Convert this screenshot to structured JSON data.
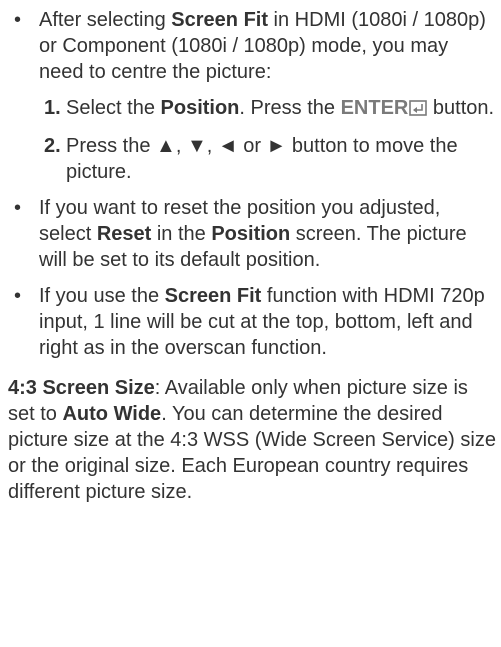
{
  "bullet1": {
    "pre": "After selecting ",
    "bold1": "Screen Fit",
    "post": " in HDMI (1080i / 1080p) or Component (1080i / 1080p) mode, you may need to centre the picture:",
    "steps": [
      {
        "num": "1.",
        "pre": "Select the ",
        "bold": "Position",
        "mid": ". Press the ",
        "button": "ENTER",
        "post": " button."
      },
      {
        "num": "2.",
        "text": "Press the ▲, ▼, ◄ or ► button to move the picture."
      }
    ]
  },
  "bullet2": {
    "pre": "If you want to reset the position you adjusted, select ",
    "bold1": "Reset",
    "mid": " in the ",
    "bold2": "Position",
    "post": " screen. The picture will be set to its default position."
  },
  "bullet3": {
    "pre": "If you use the ",
    "bold1": "Screen Fit",
    "post": " function with HDMI 720p input, 1 line will be cut at the top, bottom, left and right as in the overscan function."
  },
  "paragraph": {
    "term": "4:3 Screen Size",
    "pre": ": Available only when picture size is set to ",
    "bold": "Auto Wide",
    "post": ". You can determine the desired picture size at the 4:3 WSS (Wide Screen Service) size or the original size. Each European country requires different picture size."
  },
  "bullet_glyph": "•",
  "icons": {
    "enter": "enter-return-icon"
  },
  "colors": {
    "text": "#333333",
    "button_label": "#7a7a7a"
  }
}
